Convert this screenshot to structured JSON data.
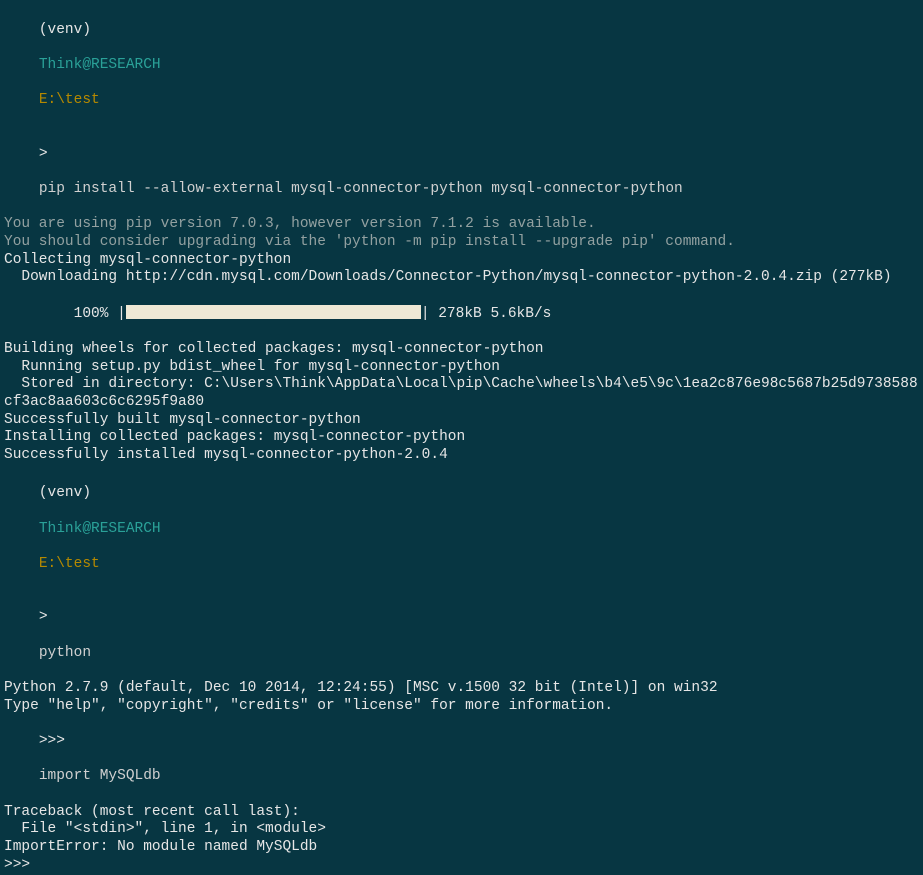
{
  "prompt1": {
    "venv": "(venv)",
    "user": "Think@RESEARCH",
    "path": "E:\\test",
    "symbol": ">",
    "command": "pip install --allow-external mysql-connector-python mysql-connector-python"
  },
  "pip_output": {
    "warn1": "You are using pip version 7.0.3, however version 7.1.2 is available.",
    "warn2": "You should consider upgrading via the 'python -m pip install --upgrade pip' command.",
    "collecting": "Collecting mysql-connector-python",
    "downloading": "  Downloading http://cdn.mysql.com/Downloads/Connector-Python/mysql-connector-python-2.0.4.zip (277kB)",
    "progress_prefix": "    100% |",
    "progress_suffix": "| 278kB 5.6kB/s",
    "building": "Building wheels for collected packages: mysql-connector-python",
    "running": "  Running setup.py bdist_wheel for mysql-connector-python",
    "stored": "  Stored in directory: C:\\Users\\Think\\AppData\\Local\\pip\\Cache\\wheels\\b4\\e5\\9c\\1ea2c876e98c5687b25d9738588cf3ac8aa603c6c6295f9a80",
    "built": "Successfully built mysql-connector-python",
    "installing": "Installing collected packages: mysql-connector-python",
    "installed": "Successfully installed mysql-connector-python-2.0.4"
  },
  "prompt2": {
    "venv": "(venv)",
    "user": "Think@RESEARCH",
    "path": "E:\\test",
    "symbol": ">",
    "command": "python"
  },
  "python_output": {
    "banner": "Python 2.7.9 (default, Dec 10 2014, 12:24:55) [MSC v.1500 32 bit (Intel)] on win32",
    "help": "Type \"help\", \"copyright\", \"credits\" or \"license\" for more information.",
    "repl_prompt": ">>>",
    "import_cmd": "import MySQLdb",
    "traceback": "Traceback (most recent call last):",
    "file_line": "  File \"<stdin>\", line 1, in <module>",
    "error": "ImportError: No module named MySQLdb",
    "final_prompt": ">>>"
  }
}
